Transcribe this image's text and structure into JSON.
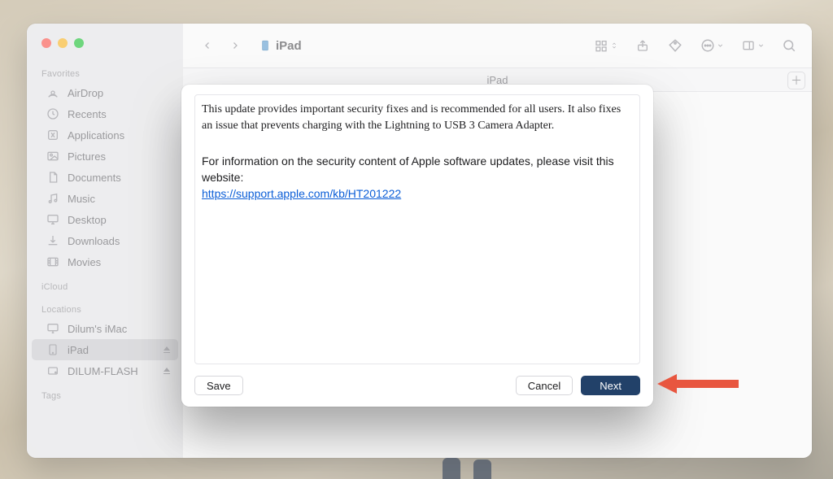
{
  "window": {
    "title": "iPad",
    "subbar_label": "iPad"
  },
  "sidebar": {
    "sections": [
      {
        "header": "Favorites",
        "items": [
          {
            "label": "AirDrop",
            "icon": "airdrop-icon"
          },
          {
            "label": "Recents",
            "icon": "clock-icon"
          },
          {
            "label": "Applications",
            "icon": "app-icon"
          },
          {
            "label": "Pictures",
            "icon": "image-icon"
          },
          {
            "label": "Documents",
            "icon": "doc-icon"
          },
          {
            "label": "Music",
            "icon": "music-icon"
          },
          {
            "label": "Desktop",
            "icon": "desktop-icon"
          },
          {
            "label": "Downloads",
            "icon": "download-icon"
          },
          {
            "label": "Movies",
            "icon": "movie-icon"
          }
        ]
      },
      {
        "header": "iCloud",
        "items": []
      },
      {
        "header": "Locations",
        "items": [
          {
            "label": "Dilum's iMac",
            "icon": "imac-icon"
          },
          {
            "label": "iPad",
            "icon": "ipad-icon",
            "selected": true,
            "eject": true
          },
          {
            "label": "DILUM-FLASH",
            "icon": "drive-icon",
            "eject": true
          }
        ]
      },
      {
        "header": "Tags",
        "items": []
      }
    ]
  },
  "modal": {
    "description": "This update provides important security fixes and is recommended for all users. It also fixes an issue that prevents charging with the Lightning to USB 3 Camera Adapter.",
    "info_prefix": "For information on the security content of Apple software updates, please visit this website:",
    "link_text": "https://support.apple.com/kb/HT201222",
    "buttons": {
      "save": "Save",
      "cancel": "Cancel",
      "next": "Next"
    }
  }
}
